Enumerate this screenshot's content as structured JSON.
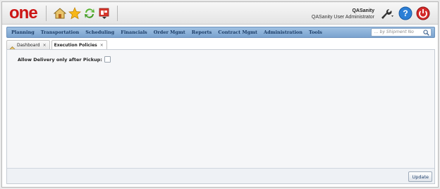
{
  "header": {
    "logo_text": "one",
    "user_name": "QASanity",
    "user_role": "QASanity User Administrator",
    "icons": [
      "home-icon",
      "favorites-star-icon",
      "refresh-icon",
      "report-icon",
      "wrench-icon",
      "help-icon",
      "power-icon"
    ]
  },
  "menu": {
    "items": [
      {
        "label": "Planning"
      },
      {
        "label": "Transportation"
      },
      {
        "label": "Scheduling"
      },
      {
        "label": "Financials"
      },
      {
        "label": "Order Mgmt"
      },
      {
        "label": "Reports"
      },
      {
        "label": "Contract Mgmt"
      },
      {
        "label": "Administration"
      },
      {
        "label": "Tools"
      }
    ],
    "search_placeholder": "... by Shipment No"
  },
  "tabs": [
    {
      "label": "Dashboard",
      "close": "×",
      "active": false
    },
    {
      "label": "Execution Policies",
      "close": "×",
      "active": true
    }
  ],
  "form": {
    "allow_delivery_label": "Allow Delivery only after Pickup:",
    "allow_delivery_checked": false
  },
  "footer": {
    "update_label": "Update"
  },
  "colors": {
    "logo": "#cc1414",
    "menu_bar": "#8fb3db",
    "menu_text": "#1b3c66",
    "help_blue": "#2c7fd6",
    "power_red": "#d42a2a"
  }
}
